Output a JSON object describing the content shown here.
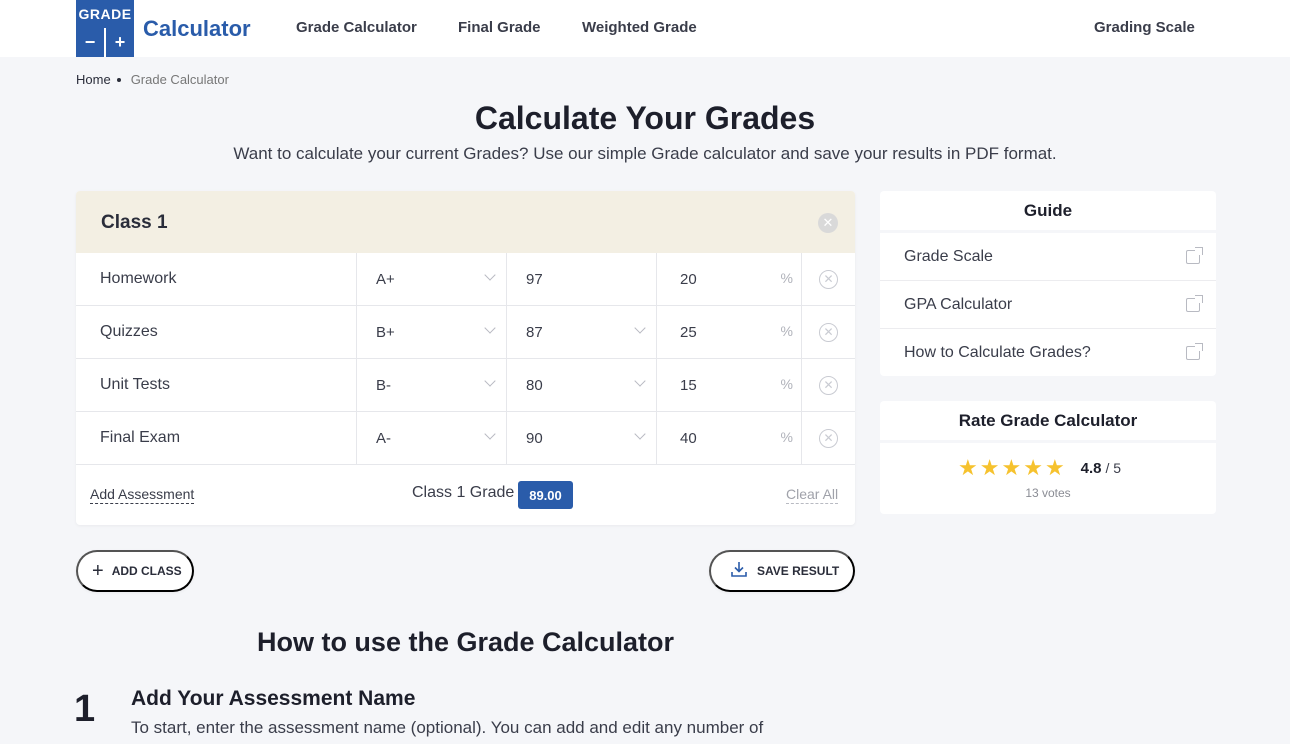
{
  "header": {
    "logo_top": "GRADE",
    "logo_minus": "−",
    "logo_plus": "+",
    "logo_text": "Calculator",
    "nav": [
      "Grade Calculator",
      "Final Grade",
      "Weighted Grade",
      "Grading Scale"
    ]
  },
  "breadcrumb": {
    "home": "Home",
    "current": "Grade Calculator"
  },
  "page": {
    "title": "Calculate Your Grades",
    "subtitle": "Want to calculate your current Grades? Use our simple Grade calculator and save your results in PDF format."
  },
  "calculator": {
    "class_title": "Class 1",
    "rows": [
      {
        "name": "Homework",
        "grade": "A+",
        "score": "97",
        "weight": "20"
      },
      {
        "name": "Quizzes",
        "grade": "B+",
        "score": "87",
        "weight": "25"
      },
      {
        "name": "Unit Tests",
        "grade": "B-",
        "score": "80",
        "weight": "15"
      },
      {
        "name": "Final Exam",
        "grade": "A-",
        "score": "90",
        "weight": "40"
      }
    ],
    "percent_symbol": "%",
    "add_assessment": "Add Assessment",
    "class_grade_label": "Class 1 Grade",
    "class_grade_value": "89.00",
    "clear_all": "Clear All"
  },
  "actions": {
    "add_class": "ADD CLASS",
    "save_result": "SAVE RESULT"
  },
  "howto": {
    "title": "How to use the Grade Calculator",
    "step_number": "1",
    "step_title": "Add Your Assessment Name",
    "step_text": "To start, enter the assessment name (optional). You can add and edit any number of"
  },
  "guide": {
    "title": "Guide",
    "items": [
      "Grade Scale",
      "GPA Calculator",
      "How to Calculate Grades?"
    ]
  },
  "rating": {
    "title": "Rate Grade Calculator",
    "value": "4.8",
    "max": "/ 5",
    "votes": "13 votes",
    "stars": 5
  },
  "colors": {
    "brand": "#2a5caa",
    "star": "#f6c22e",
    "class_header": "#f3efe3"
  }
}
